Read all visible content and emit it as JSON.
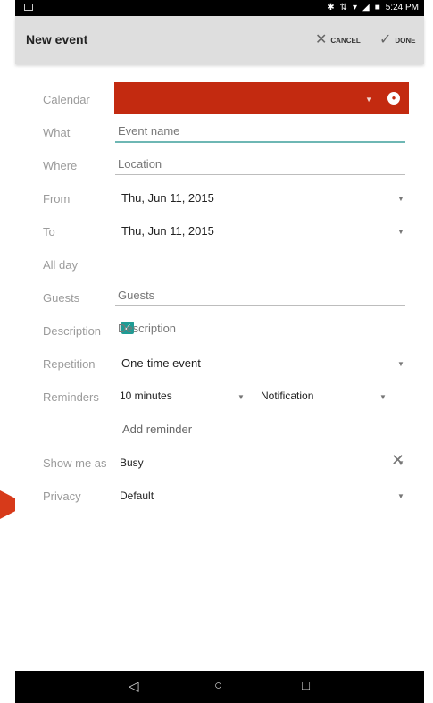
{
  "status_bar": {
    "time": "5:24 PM",
    "icons": [
      "bluetooth-icon",
      "data-icon",
      "wifi-icon",
      "signal-icon",
      "battery-icon"
    ]
  },
  "app_bar": {
    "title": "New event",
    "cancel_label": "CANCEL",
    "done_label": "DONE"
  },
  "form": {
    "calendar": {
      "label": "Calendar",
      "color": "#c32a10"
    },
    "what": {
      "label": "What",
      "placeholder": "Event name"
    },
    "where": {
      "label": "Where",
      "placeholder": "Location"
    },
    "from": {
      "label": "From",
      "value": "Thu, Jun 11, 2015"
    },
    "to": {
      "label": "To",
      "value": "Thu, Jun 11, 2015"
    },
    "all_day": {
      "label": "All day",
      "checked": true
    },
    "guests": {
      "label": "Guests",
      "placeholder": "Guests"
    },
    "description": {
      "label": "Description",
      "placeholder": "Description"
    },
    "repetition": {
      "label": "Repetition",
      "value": "One-time event"
    },
    "reminders": {
      "label": "Reminders",
      "time_value": "10 minutes",
      "method_value": "Notification",
      "add_label": "Add reminder"
    },
    "show_me_as": {
      "label": "Show me as",
      "value": "Busy"
    },
    "privacy": {
      "label": "Privacy",
      "value": "Default"
    }
  },
  "pointer_color": "#d73a1a",
  "accent_color": "#1f9b94"
}
